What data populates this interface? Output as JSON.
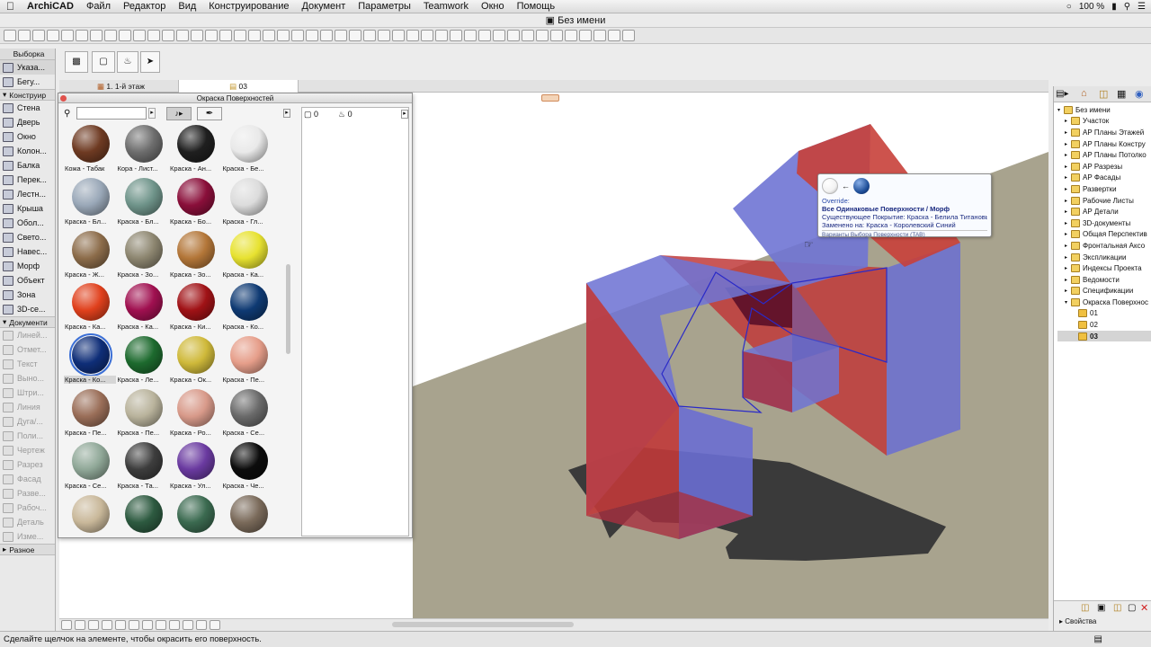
{
  "menubar": {
    "app": "ArchiCAD",
    "items": [
      "Файл",
      "Редактор",
      "Вид",
      "Конструирование",
      "Документ",
      "Параметры",
      "Teamwork",
      "Окно",
      "Помощь"
    ],
    "battery": "100 %"
  },
  "window": {
    "title": "Без имени"
  },
  "toolbox": {
    "header": "Выборка",
    "top": [
      {
        "label": "Указа...",
        "state": "sel"
      },
      {
        "label": "Бегу...",
        "state": ""
      }
    ],
    "sections": [
      {
        "label": "Конструир",
        "items": [
          "Стена",
          "Дверь",
          "Окно",
          "Колон...",
          "Балка",
          "Перек...",
          "Лестн...",
          "Крыша",
          "Обол...",
          "Свето...",
          "Навес...",
          "Морф",
          "Объект",
          "Зона",
          "3D-се..."
        ],
        "dim": false
      },
      {
        "label": "Документи",
        "items": [
          "Линей...",
          "Отмет...",
          "Текст",
          "Выно...",
          "Штри...",
          "Линия",
          "Дуга/...",
          "Поли...",
          "Чертеж",
          "Разрез",
          "Фасад",
          "Разве...",
          "Рабоч...",
          "Деталь",
          "Изме..."
        ],
        "dim": true
      },
      {
        "label": "Разное",
        "items": [],
        "dim": false
      }
    ]
  },
  "tabs": [
    {
      "label": "1. 1-й этаж",
      "active": false
    },
    {
      "label": "03",
      "active": true
    }
  ],
  "surface_panel": {
    "title": "Окраска Поверхностей",
    "search_placeholder": "",
    "counts": [
      "0",
      "0"
    ],
    "swatches": [
      {
        "label": "Кожа - Табак",
        "color": "#6e3a22"
      },
      {
        "label": "Кора - Лист...",
        "color": "#6d6d6d"
      },
      {
        "label": "Краска - Ан...",
        "color": "#1f1f1f"
      },
      {
        "label": "Краска - Бе...",
        "color": "#e9e9e9"
      },
      {
        "label": "Краска - Бл...",
        "color": "#9aa8b8"
      },
      {
        "label": "Краска - Бл...",
        "color": "#6f948a"
      },
      {
        "label": "Краска - Бо...",
        "color": "#8a0f3a"
      },
      {
        "label": "Краска - Гл...",
        "color": "#dcdcdc"
      },
      {
        "label": "Краска - Ж...",
        "color": "#8c6c4a"
      },
      {
        "label": "Краска - Зо...",
        "color": "#8d8670"
      },
      {
        "label": "Краска - Зо...",
        "color": "#b37638"
      },
      {
        "label": "Краска - Ка...",
        "color": "#e7e230"
      },
      {
        "label": "Краска - Ка...",
        "color": "#e0401c"
      },
      {
        "label": "Краска - Ка...",
        "color": "#a01050"
      },
      {
        "label": "Краска - Ки...",
        "color": "#a01216"
      },
      {
        "label": "Краска - Ко...",
        "color": "#0f3a73"
      },
      {
        "label": "Краска - Ко...",
        "color": "#0f2e78",
        "sel": true
      },
      {
        "label": "Краска - Ле...",
        "color": "#1d6a2e"
      },
      {
        "label": "Краска - Ок...",
        "color": "#cfb93a"
      },
      {
        "label": "Краска - Пе...",
        "color": "#e69e8a"
      },
      {
        "label": "Краска - Пе...",
        "color": "#9a6e58"
      },
      {
        "label": "Краска - Пе...",
        "color": "#b9b39c"
      },
      {
        "label": "Краска - Ро...",
        "color": "#d89a8a"
      },
      {
        "label": "Краска - Се...",
        "color": "#6a6a6a"
      },
      {
        "label": "Краска - Се...",
        "color": "#90a898"
      },
      {
        "label": "Краска - Та...",
        "color": "#3d3d3d"
      },
      {
        "label": "Краска - Ул...",
        "color": "#6a3aa0"
      },
      {
        "label": "Краска - Че...",
        "color": "#0c0c0c"
      },
      {
        "label": "",
        "color": "#c9b89a"
      },
      {
        "label": "",
        "color": "#2d5a40"
      },
      {
        "label": "",
        "color": "#3b6a50"
      },
      {
        "label": "",
        "color": "#7a6a5a"
      }
    ]
  },
  "tooltip": {
    "kind": "Override:",
    "headline": "Все Одинаковые Поверхности / Морф",
    "existing": "Существующее Покрытие: Краска - Белила Титановые",
    "replaced": "Заменено на: Краска - Королевский Синий",
    "hint": "Варианты Выбора Поверхности (TAB)",
    "from_color": "#f2f2f2",
    "to_color": "#1f4f99"
  },
  "navigator": {
    "items": [
      {
        "label": "Без имени",
        "level": 0
      },
      {
        "label": "Участок",
        "level": 1
      },
      {
        "label": "АР Планы Этажей",
        "level": 1
      },
      {
        "label": "АР Планы Констру",
        "level": 1
      },
      {
        "label": "АР Планы Потолко",
        "level": 1
      },
      {
        "label": "АР Разрезы",
        "level": 1
      },
      {
        "label": "АР Фасады",
        "level": 1
      },
      {
        "label": "Развертки",
        "level": 1
      },
      {
        "label": "Рабочие Листы",
        "level": 1
      },
      {
        "label": "АР Детали",
        "level": 1
      },
      {
        "label": "3D-документы",
        "level": 1
      },
      {
        "label": "Общая Перспектив",
        "level": 1
      },
      {
        "label": "Фронтальная Аксо",
        "level": 1
      },
      {
        "label": "Экспликации",
        "level": 1
      },
      {
        "label": "Индексы Проекта",
        "level": 1
      },
      {
        "label": "Ведомости",
        "level": 1
      },
      {
        "label": "Спецификации",
        "level": 1
      },
      {
        "label": "Окраска Поверхнос",
        "level": 1
      },
      {
        "label": "01",
        "level": 2
      },
      {
        "label": "02",
        "level": 2
      },
      {
        "label": "03",
        "level": 2,
        "sel": true
      }
    ],
    "properties_label": "Свойства"
  },
  "status": {
    "text": "Сделайте щелчок на элементе, чтобы окрасить его поверхность."
  },
  "colors": {
    "accent": "#3b6fd6",
    "red_face": "#c03a3a",
    "blue_face": "#6f74d4",
    "ground": "#a8a38e"
  }
}
